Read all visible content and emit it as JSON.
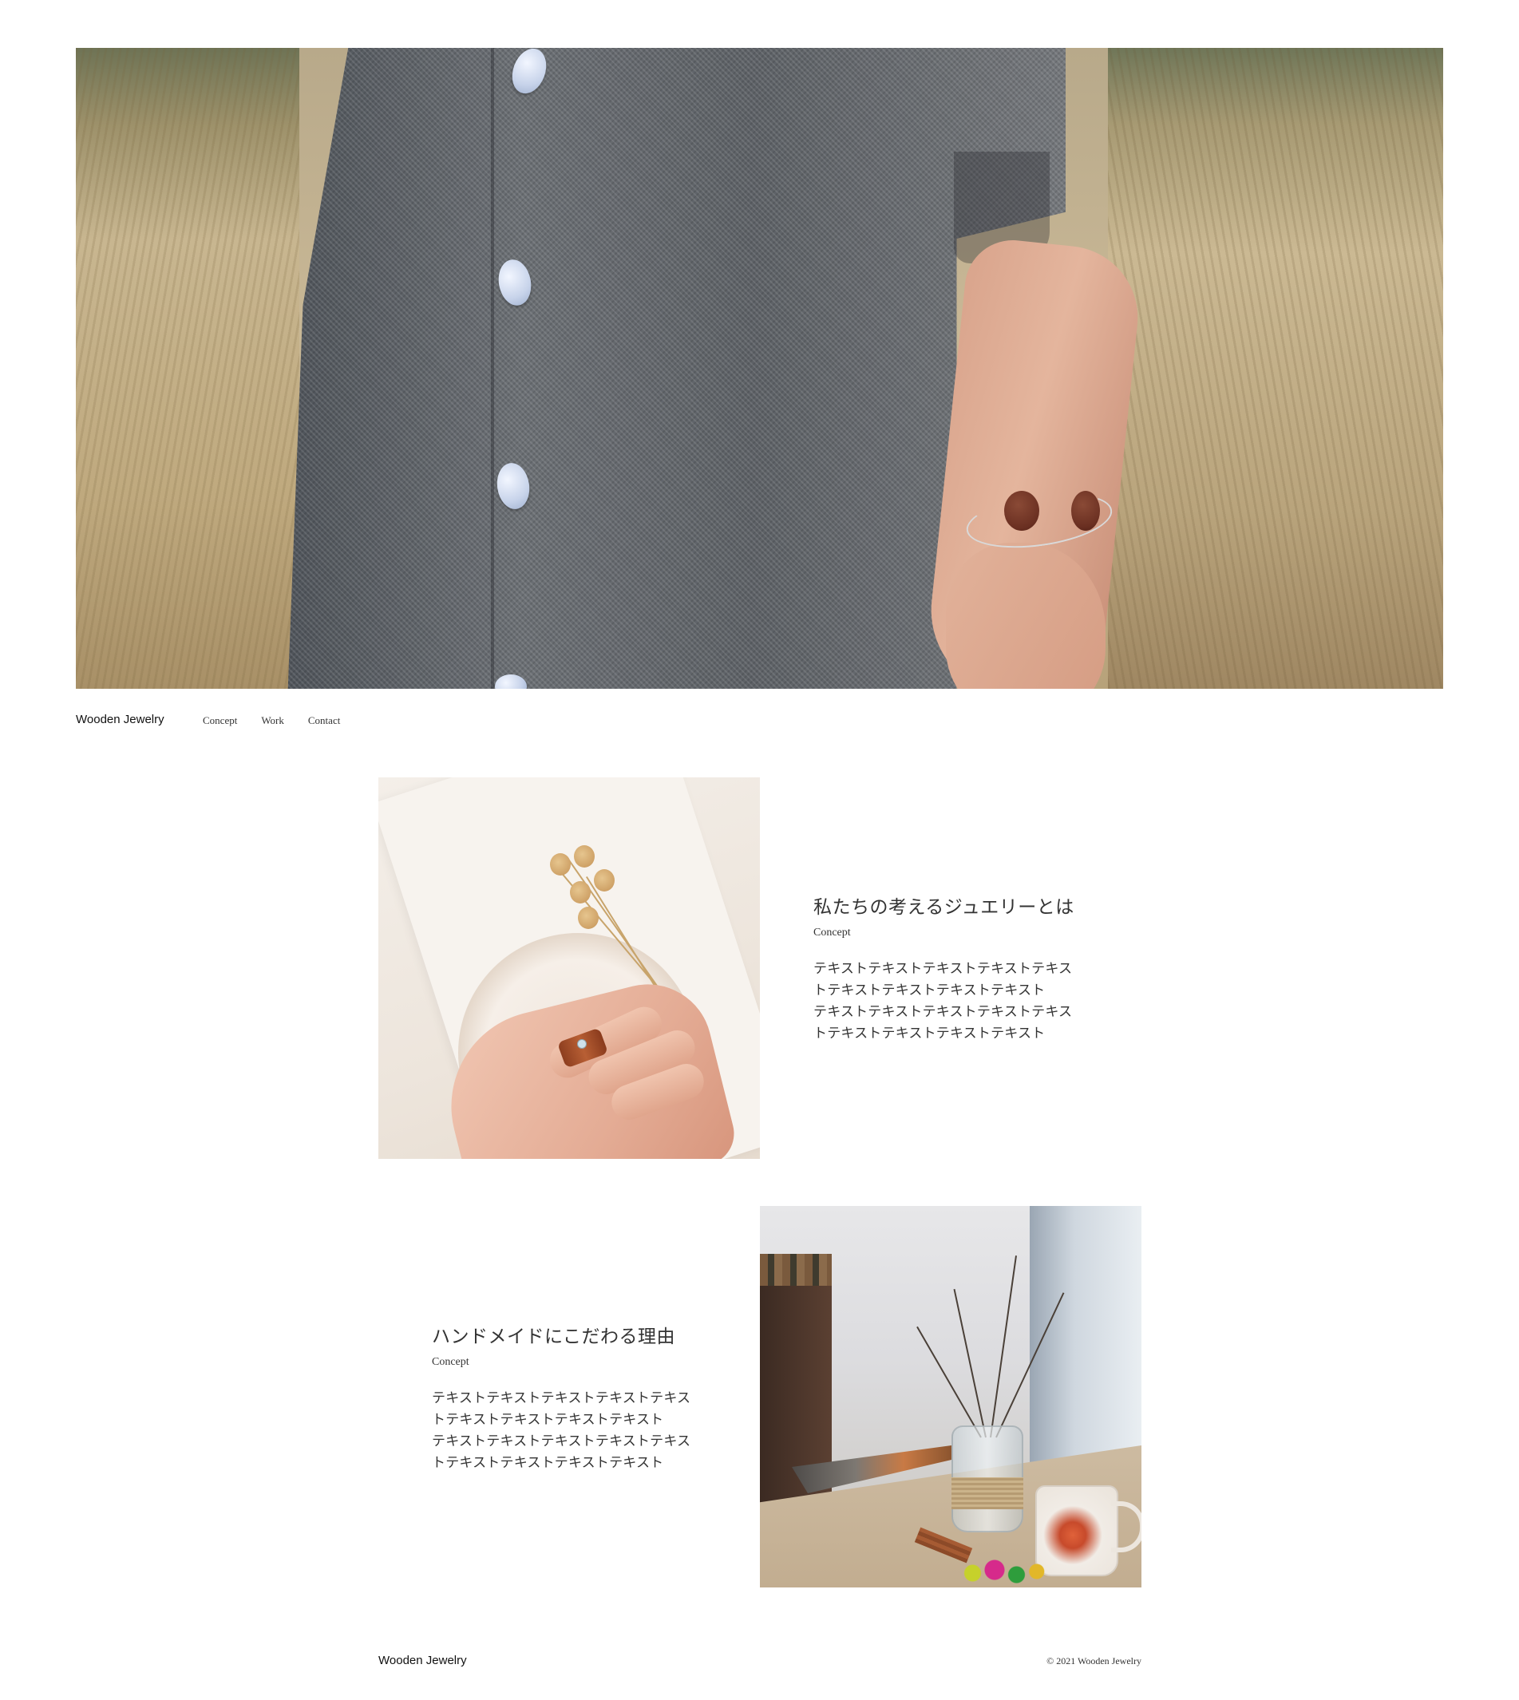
{
  "header": {
    "brand": "Wooden Jewelry",
    "nav": [
      "Concept",
      "Work",
      "Contact"
    ]
  },
  "hero": {
    "image_subject": "dress-with-wooden-bangle-photo"
  },
  "sections": [
    {
      "title": "私たちの考えるジュエリーとは",
      "subtitle": "Concept",
      "body": "テキストテキストテキストテキストテキストテキストテキストテキストテキスト\nテキストテキストテキストテキストテキストテキストテキストテキストテキスト"
    },
    {
      "title": "ハンドメイドにこだわる理由",
      "subtitle": "Concept",
      "body": "テキストテキストテキストテキストテキストテキストテキストテキストテキスト\nテキストテキストテキストテキストテキストテキストテキストテキストテキスト"
    }
  ],
  "footer": {
    "brand": "Wooden Jewelry",
    "copyright": "© 2021 Wooden Jewelry"
  }
}
